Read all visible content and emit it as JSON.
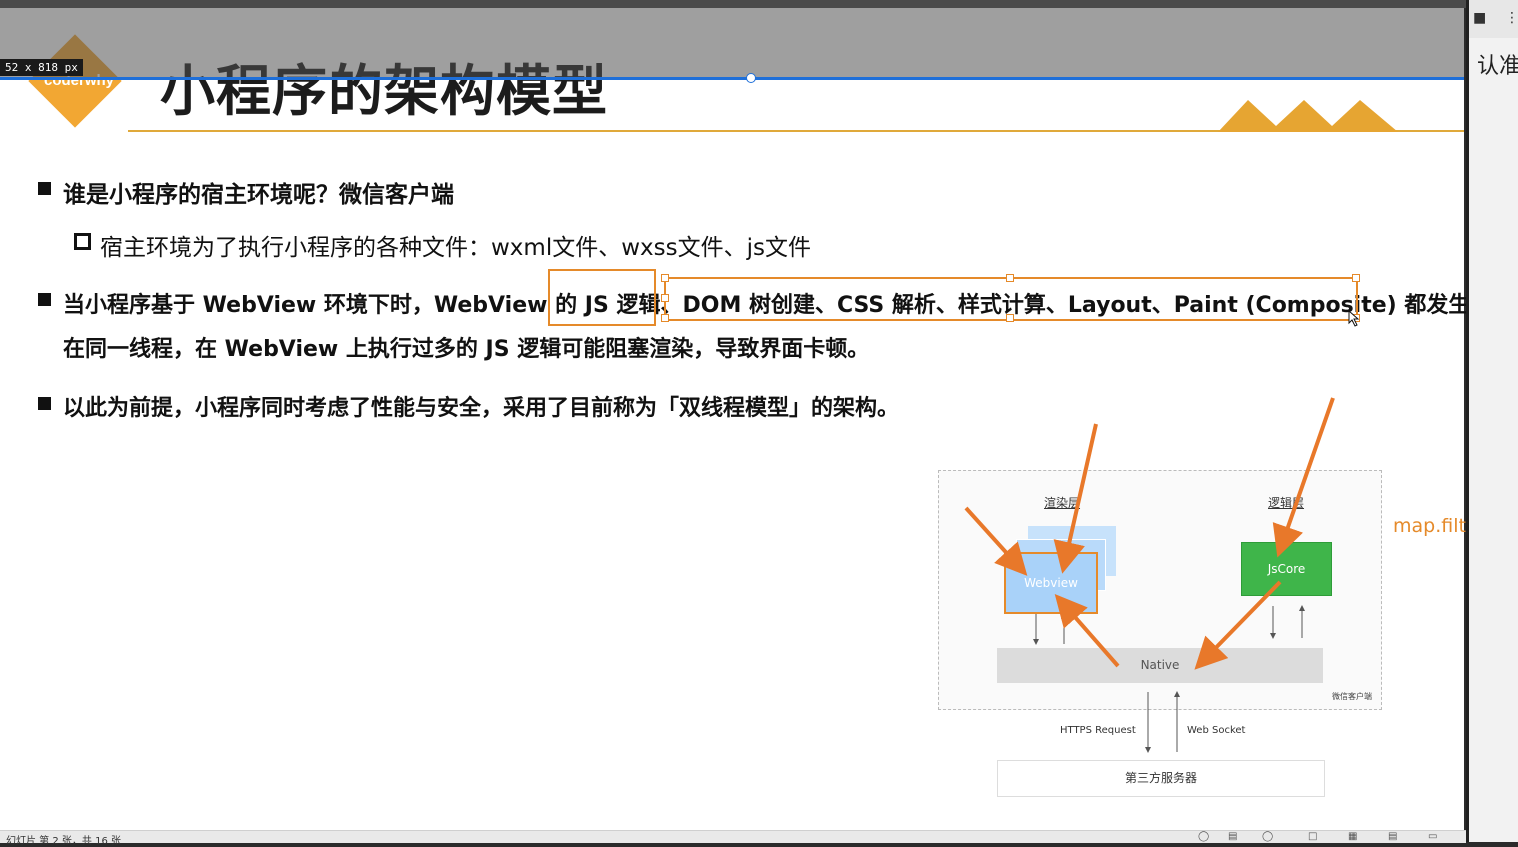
{
  "slide": {
    "logo_text": "coderwhy",
    "title": "小程序的架构模型",
    "bullets": {
      "b1": "谁是小程序的宿主环境呢？微信客户端",
      "b1_sub": "宿主环境为了执行小程序的各种文件：wxml文件、wxss文件、js文件",
      "b2_line1": "当小程序基于 WebView 环境下时，WebView 的 JS 逻辑、DOM 树创建、CSS 解析、样式计算、Layout、Paint (Composite) 都发生",
      "b2_line2": "在同一线程，在 WebView 上执行过多的 JS 逻辑可能阻塞渲染，导致界面卡顿。",
      "b3": "以此为前提，小程序同时考虑了性能与安全，采用了目前称为「双线程模型」的架构。"
    },
    "diagram": {
      "render_layer": "渲染层",
      "logic_layer": "逻辑层",
      "webview": "Webview",
      "jscore": "JsCore",
      "native": "Native",
      "client_note": "微信客户端",
      "https": "HTTPS Request",
      "websocket": "Web Socket",
      "server": "第三方服务器"
    },
    "side_note": "map.filter.find"
  },
  "editor": {
    "size_label": "52 x 818  px"
  },
  "right_panel": {
    "text": "认准-"
  },
  "status": {
    "text": "幻灯片 第 2 张，共 16 张"
  },
  "colors": {
    "accent": "#e58a2a",
    "logo": "#f2a733",
    "guide": "#1e6fd9",
    "jscore": "#3fb54a",
    "webview": "#a9d2f9"
  }
}
